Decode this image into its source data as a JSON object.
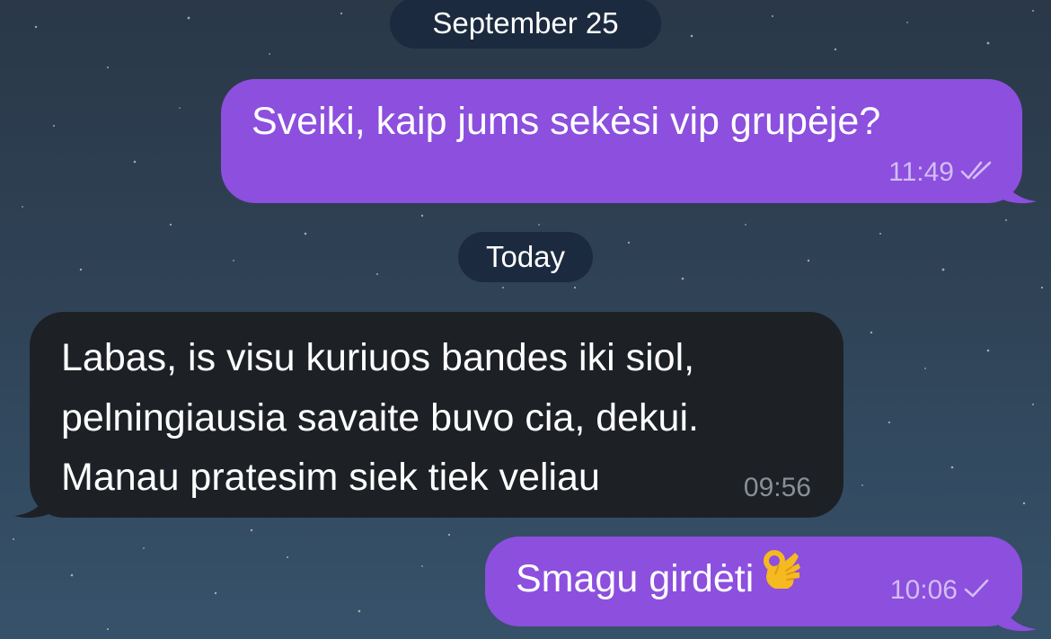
{
  "chat": {
    "date_separators": [
      "September 25",
      "Today"
    ],
    "messages": [
      {
        "direction": "outgoing",
        "text": "Sveiki, kaip jums sekėsi vip grupėje?",
        "time": "11:49",
        "status_icon": "double-check-icon"
      },
      {
        "direction": "incoming",
        "lines": [
          "Labas, is visu kuriuos bandes iki siol,",
          "pelningiausia savaite buvo cia, dekui.",
          "Manau pratesim siek tiek veliau"
        ],
        "time": "09:56"
      },
      {
        "direction": "outgoing",
        "text": "Smagu girdėti",
        "emoji": "ok-hand-emoji",
        "time": "10:06",
        "status_icon": "single-check-icon"
      }
    ]
  },
  "colors": {
    "outgoing_bubble": "#8c4fde",
    "incoming_bubble": "#1d2126",
    "date_pill": "#1c2a3f",
    "background": "#2f4256"
  }
}
